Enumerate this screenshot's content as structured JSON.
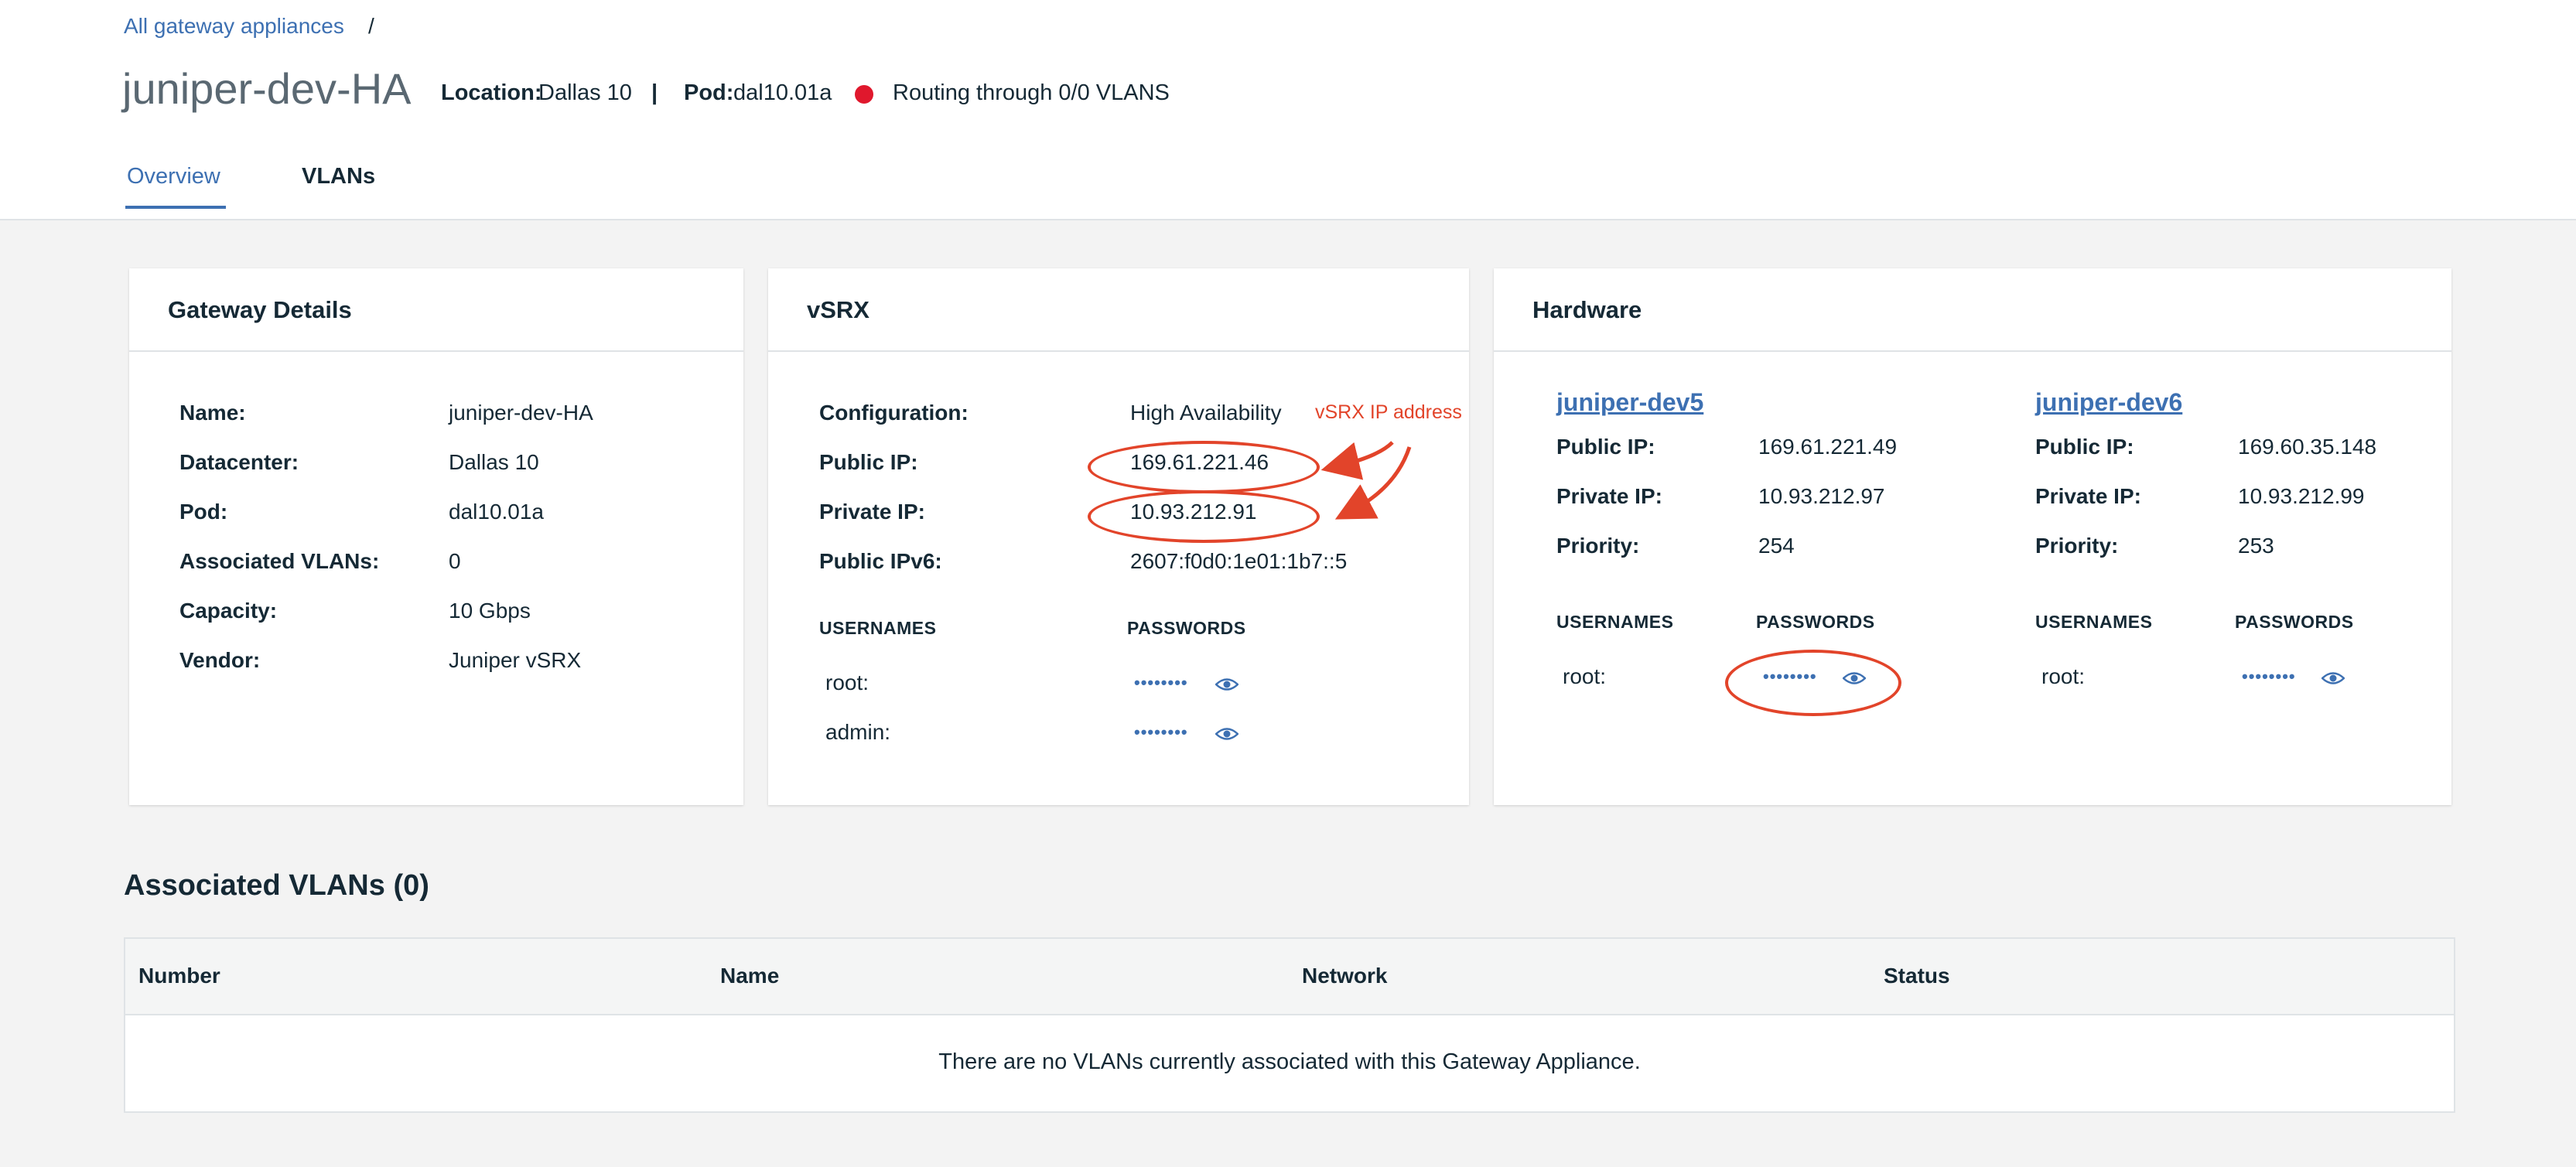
{
  "breadcrumb": {
    "link": "All gateway appliances",
    "separator": "/"
  },
  "header": {
    "title": "juniper-dev-HA",
    "location_label": "Location:",
    "location_value": "Dallas 10",
    "divider": "|",
    "pod_label": "Pod:",
    "pod_value": "dal10.01a",
    "status_text": "Routing through 0/0 VLANS",
    "status_color": "#e0182d"
  },
  "tabs": [
    {
      "label": "Overview",
      "active": true
    },
    {
      "label": "VLANs",
      "active": false
    }
  ],
  "gateway_details": {
    "title": "Gateway Details",
    "rows": [
      {
        "label": "Name:",
        "value": "juniper-dev-HA"
      },
      {
        "label": "Datacenter:",
        "value": "Dallas 10"
      },
      {
        "label": "Pod:",
        "value": "dal10.01a"
      },
      {
        "label": "Associated VLANs:",
        "value": "0"
      },
      {
        "label": "Capacity:",
        "value": "10 Gbps"
      },
      {
        "label": "Vendor:",
        "value": "Juniper vSRX"
      }
    ]
  },
  "vsrx": {
    "title": "vSRX",
    "rows": [
      {
        "label": "Configuration:",
        "value": "High Availability"
      },
      {
        "label": "Public IP:",
        "value": "169.61.221.46"
      },
      {
        "label": "Private IP:",
        "value": "10.93.212.91"
      },
      {
        "label": "Public IPv6:",
        "value": "2607:f0d0:1e01:1b7::5"
      }
    ],
    "usernames_header": "USERNAMES",
    "passwords_header": "PASSWORDS",
    "credentials": [
      {
        "user": "root:",
        "password_mask": "••••••••"
      },
      {
        "user": "admin:",
        "password_mask": "••••••••"
      }
    ],
    "annotation": "vSRX IP address"
  },
  "hardware": {
    "title": "Hardware",
    "members": [
      {
        "name": "juniper-dev5",
        "rows": [
          {
            "label": "Public IP:",
            "value": "169.61.221.49"
          },
          {
            "label": "Private IP:",
            "value": "10.93.212.97"
          },
          {
            "label": "Priority:",
            "value": "254"
          }
        ],
        "usernames_header": "USERNAMES",
        "passwords_header": "PASSWORDS",
        "credentials": [
          {
            "user": "root:",
            "password_mask": "••••••••"
          }
        ]
      },
      {
        "name": "juniper-dev6",
        "rows": [
          {
            "label": "Public IP:",
            "value": "169.60.35.148"
          },
          {
            "label": "Private IP:",
            "value": "10.93.212.99"
          },
          {
            "label": "Priority:",
            "value": "253"
          }
        ],
        "usernames_header": "USERNAMES",
        "passwords_header": "PASSWORDS",
        "credentials": [
          {
            "user": "root:",
            "password_mask": "••••••••"
          }
        ]
      }
    ]
  },
  "associated_vlans": {
    "title": "Associated VLANs (0)",
    "columns": [
      "Number",
      "Name",
      "Network",
      "Status"
    ],
    "empty_message": "There are no VLANs currently associated with this Gateway Appliance."
  },
  "colors": {
    "accent": "#3d70b2",
    "annotation": "#e2442a"
  }
}
